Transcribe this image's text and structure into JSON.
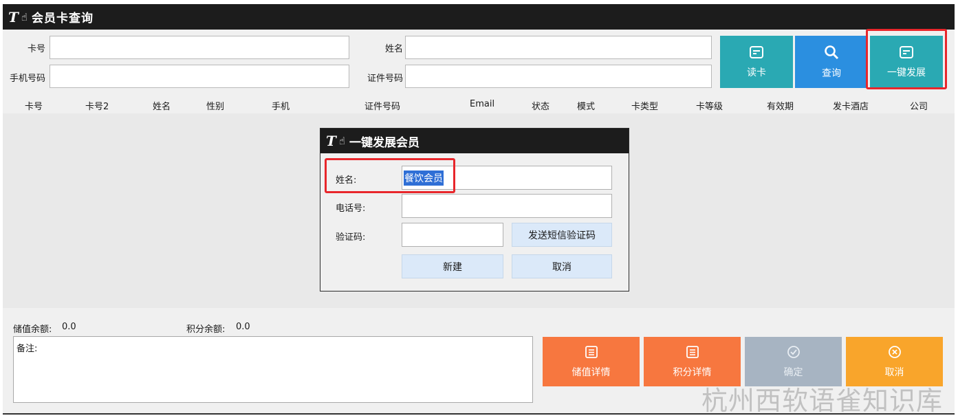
{
  "window": {
    "logo": "T",
    "title": "会员卡查询"
  },
  "search": {
    "card_no_label": "卡号",
    "card_no_value": "",
    "name_label": "姓名",
    "name_value": "",
    "phone_label": "手机号码",
    "phone_value": "",
    "id_no_label": "证件号码",
    "id_no_value": ""
  },
  "toolbar": {
    "read_card": "读卡",
    "query": "查询",
    "quick_register": "一键发展",
    "card_icon": "card-icon",
    "search_icon": "search-icon"
  },
  "table": {
    "columns": [
      "卡号",
      "卡号2",
      "姓名",
      "性别",
      "手机",
      "证件号码",
      "Email",
      "状态",
      "模式",
      "卡类型",
      "卡等级",
      "有效期",
      "发卡酒店",
      "公司"
    ],
    "rows": []
  },
  "summary": {
    "stored_balance_label": "储值余额:",
    "stored_balance_value": "0.0",
    "points_balance_label": "积分余额:",
    "points_balance_value": "0.0",
    "remarks_label": "备注:"
  },
  "actions": {
    "stored_details": "储值详情",
    "points_details": "积分详情",
    "confirm": "确定",
    "cancel": "取消"
  },
  "dialog": {
    "title": "一键发展会员",
    "name_label": "姓名:",
    "name_value": "餐饮会员",
    "phone_label": "电话号:",
    "phone_value": "",
    "code_label": "验证码:",
    "code_value": "",
    "send_code": "发送短信验证码",
    "create": "新建",
    "cancel": "取消"
  },
  "watermark": "杭州西软语雀知识库",
  "colors": {
    "titlebar": "#1c1c1c",
    "teal": "#2aa9b3",
    "blue": "#2b8fe0",
    "orange": "#f7773f",
    "gray": "#a7b4c2",
    "amber": "#f9a52b",
    "highlight": "#e8262b",
    "selection": "#2f6fd6"
  }
}
